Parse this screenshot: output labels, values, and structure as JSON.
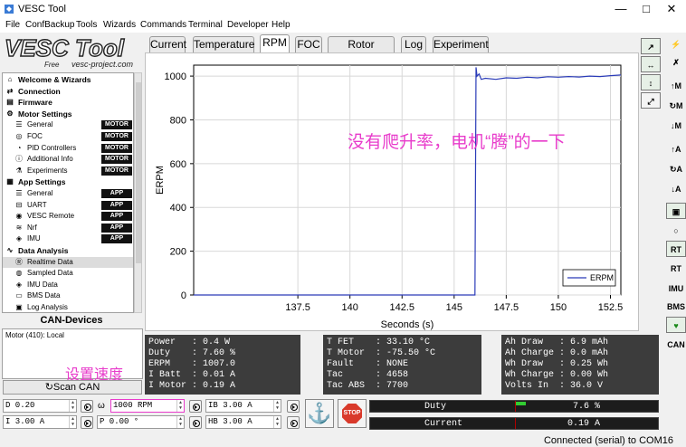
{
  "window": {
    "title": "VESC Tool"
  },
  "menu": [
    "File",
    "ConfBackup",
    "Tools",
    "Wizards",
    "Commands",
    "Terminal",
    "Developer",
    "Help"
  ],
  "logo": {
    "text": "VESC Tool",
    "sub_free": "Free",
    "sub_url": "vesc-project.com"
  },
  "nav": [
    {
      "label": "Welcome & Wizards",
      "icon": "home-icon",
      "bold": true
    },
    {
      "label": "Connection",
      "icon": "connection-icon",
      "bold": true
    },
    {
      "label": "Firmware",
      "icon": "firmware-icon",
      "bold": true
    },
    {
      "label": "Motor Settings",
      "icon": "motor-icon",
      "bold": true
    },
    {
      "label": "General",
      "icon": "sliders-icon",
      "badge": "MOTOR"
    },
    {
      "label": "FOC",
      "icon": "foc-icon",
      "badge": "MOTOR"
    },
    {
      "label": "PID Controllers",
      "icon": "gauge-icon",
      "badge": "MOTOR"
    },
    {
      "label": "Additional Info",
      "icon": "info-icon",
      "badge": "MOTOR"
    },
    {
      "label": "Experiments",
      "icon": "experiment-icon",
      "badge": "MOTOR"
    },
    {
      "label": "App Settings",
      "icon": "app-icon",
      "bold": true
    },
    {
      "label": "General",
      "icon": "sliders-icon",
      "badge": "APP"
    },
    {
      "label": "UART",
      "icon": "uart-icon",
      "badge": "APP"
    },
    {
      "label": "VESC Remote",
      "icon": "remote-icon",
      "badge": "APP"
    },
    {
      "label": "Nrf",
      "icon": "wireless-icon",
      "badge": "APP"
    },
    {
      "label": "IMU",
      "icon": "imu-icon",
      "badge": "APP"
    },
    {
      "label": "Data Analysis",
      "icon": "analysis-icon",
      "bold": true
    },
    {
      "label": "Realtime Data",
      "icon": "realtime-icon",
      "selected": true
    },
    {
      "label": "Sampled Data",
      "icon": "sampled-icon"
    },
    {
      "label": "IMU Data",
      "icon": "imu-icon"
    },
    {
      "label": "BMS Data",
      "icon": "bms-icon"
    },
    {
      "label": "Log Analysis",
      "icon": "log-icon"
    }
  ],
  "can": {
    "header": "CAN-Devices",
    "item": "Motor (410): Local",
    "scan_label": "Scan CAN",
    "annotation": "设置速度"
  },
  "tabs": [
    "Current",
    "Temperature",
    "RPM",
    "FOC",
    "Rotor Position",
    "Log",
    "Experiment"
  ],
  "active_tab": "RPM",
  "annotation": "没有爬升率，电机“腾”的一下",
  "chart_data": {
    "type": "line",
    "xlabel": "Seconds (s)",
    "ylabel": "ERPM",
    "xlim": [
      132.5,
      153.0
    ],
    "ylim": [
      0,
      1050
    ],
    "xticks": [
      "137.5",
      "140",
      "142.5",
      "145",
      "147.5",
      "150",
      "152.5"
    ],
    "yticks": [
      "0",
      "200",
      "400",
      "600",
      "800",
      "1000"
    ],
    "grid": true,
    "legend": "bottom-right",
    "series": [
      {
        "name": "ERPM",
        "color": "#2a3bb8",
        "x": [
          132.5,
          146.0,
          146.05,
          146.1,
          146.2,
          146.3,
          146.5,
          147.0,
          147.5,
          148.0,
          148.5,
          149.0,
          149.5,
          150.0,
          150.5,
          151.0,
          151.5,
          152.0,
          152.5,
          153.0
        ],
        "y": [
          0,
          0,
          1040,
          1000,
          1010,
          985,
          990,
          985,
          992,
          990,
          995,
          992,
          997,
          995,
          998,
          996,
          1000,
          998,
          1002,
          1005
        ]
      }
    ]
  },
  "stats": {
    "left": [
      "Power   : 0.4 W",
      "Duty    : 7.60 %",
      "ERPM    : 1007.0",
      "I Batt  : 0.01 A",
      "I Motor : 0.19 A"
    ],
    "mid": [
      "T FET    : 33.10 °C",
      "T Motor  : -75.50 °C",
      "Fault    : NONE",
      "Tac      : 4658",
      "Tac ABS  : 7700"
    ],
    "right": [
      "Ah Draw   : 6.9 mAh",
      "Ah Charge : 0.0 mAh",
      "Wh Draw   : 0.25 Wh",
      "Wh Charge : 0.00 Wh",
      "Volts In  : 36.0 V"
    ]
  },
  "controls": {
    "duty": "D 0.20",
    "rpm": "1000 RPM",
    "ib": "IB 3.00 A",
    "current": "I 3.00 A",
    "pos": "P 0.00 °",
    "hb": "HB 3.00 A",
    "stop_label": "STOP"
  },
  "bars": {
    "duty_label": "Duty",
    "duty_value": "7.6 %",
    "duty_fraction": 0.076,
    "current_label": "Current",
    "current_value": "0.19 A",
    "current_fraction": 0.0
  },
  "status": "Connected (serial) to COM16"
}
